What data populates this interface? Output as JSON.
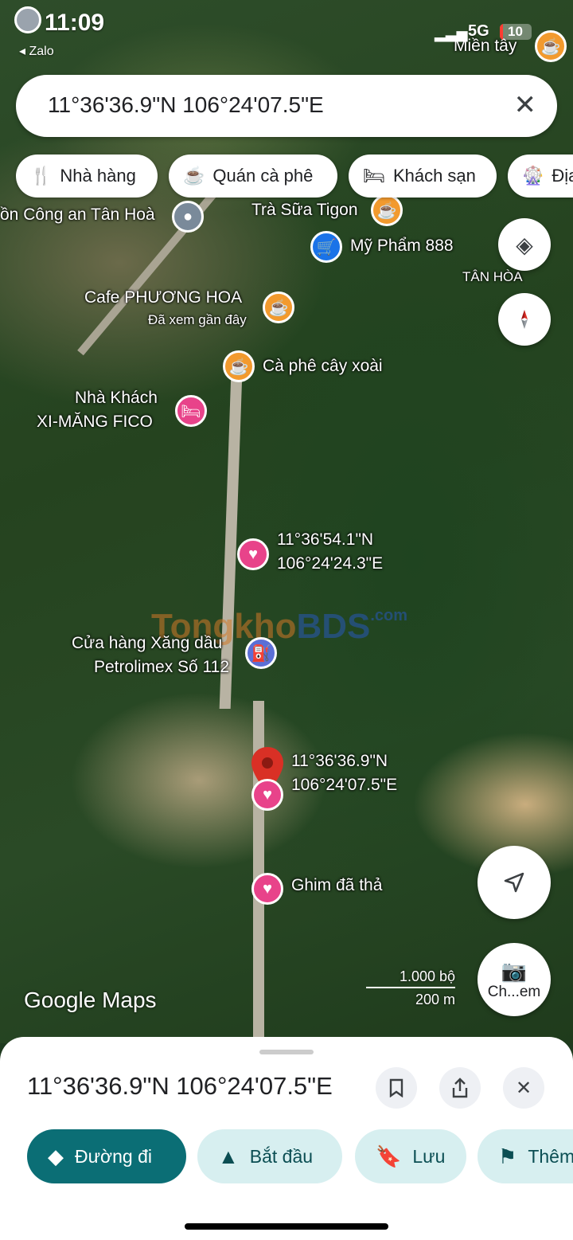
{
  "status_bar": {
    "time": "11:09",
    "back_app": "◂ Zalo",
    "network": "5G",
    "battery": "10"
  },
  "search": {
    "query": "11°36'36.9\"N 106°24'07.5\"E",
    "close_icon": "close-icon"
  },
  "chips": [
    {
      "label": "Nhà hàng",
      "icon": "restaurant-icon"
    },
    {
      "label": "Quán cà phê",
      "icon": "coffee-icon"
    },
    {
      "label": "Khách sạn",
      "icon": "hotel-icon"
    },
    {
      "label": "Địa",
      "icon": "attraction-icon"
    }
  ],
  "map_labels": {
    "mien_tay": "Miền tây",
    "cong_an": "ồn Công an Tân Hoà",
    "tra_sua": "Trà Sữa Tigon",
    "my_pham": "Mỹ Phẩm 888",
    "tan_hoa": "TÂN HÒA",
    "cafe_phuong_hoa": "Cafe PHƯƠNG HOA",
    "cafe_phuong_hoa_sub": "Đã xem gần đây",
    "ca_phe_cay_xoai": "Cà phê cây xoài",
    "nha_khach_1": "Nhà Khách",
    "nha_khach_2": "XI-MĂNG FICO",
    "pin1_lat": "11°36'54.1\"N",
    "pin1_lng": "106°24'24.3\"E",
    "xang_dau_1": "Cửa hàng Xăng dầu",
    "xang_dau_2": "Petrolimex Số 112",
    "pin_main_lat": "11°36'36.9\"N",
    "pin_main_lng": "106°24'07.5\"E",
    "ghim": "Ghim đã thả"
  },
  "watermark": {
    "part1": "Tongkho",
    "part2": "BDS",
    "suffix": ".com"
  },
  "map_controls": {
    "camera_label": "Ch...em"
  },
  "brand": "Google Maps",
  "scale": {
    "imperial": "1.000 bộ",
    "metric": "200 m"
  },
  "sheet": {
    "title": "11°36'36.9\"N 106°24'07.5\"E",
    "actions": [
      {
        "label": "Đường đi",
        "icon": "directions-icon"
      },
      {
        "label": "Bắt đầu",
        "icon": "navigation-icon"
      },
      {
        "label": "Lưu",
        "icon": "bookmark-icon"
      },
      {
        "label": "Thêm",
        "icon": "flag-icon"
      }
    ]
  },
  "colors": {
    "primary_action": "#0b6e75",
    "secondary_action": "#d7eff0",
    "pin_red": "#d93025",
    "pin_pink": "#e8438a"
  }
}
